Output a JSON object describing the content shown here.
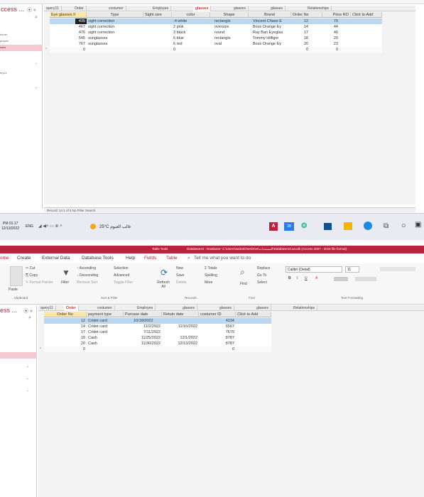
{
  "top": {
    "nav_title": "ccess ...",
    "tabs": [
      "query11",
      "Order",
      "costumer",
      "Employee",
      "glasses",
      "glasses",
      "glasses",
      "Relationships"
    ],
    "active_tab_index": 4,
    "columns": [
      "Eye glasses II",
      "Type",
      "Sight size",
      "color",
      "Shape",
      "Brand",
      "Order No",
      "Price RO",
      "Click to Add"
    ],
    "rows": [
      [
        "435",
        "sight correction",
        "",
        "-4 white",
        "rectangle",
        "Vincent Chase E",
        "12",
        "70"
      ],
      [
        "467",
        "sight correction",
        "",
        "2 pink",
        "oversize",
        "Boss Orange Ey",
        "14",
        "44"
      ],
      [
        "476",
        "sight correction",
        "",
        "3 black",
        "round",
        "Ray Ban Eyeglas",
        "17",
        "40"
      ],
      [
        "545",
        "sunglasses",
        "",
        "6 blue",
        "rectangle",
        "Tommy Hilfiger",
        "18",
        "20"
      ],
      [
        "767",
        "sunglasses",
        "",
        "6 red",
        "oval",
        "Boss Orange Ey",
        "20",
        "23"
      ],
      [
        "0",
        "",
        "",
        "0",
        "",
        "",
        "0",
        "0"
      ]
    ],
    "nav_items": [
      "tumer",
      "ployee",
      "sses",
      "ery11"
    ],
    "record_nav": "Record: 14  1 of 5   No Filter  Search"
  },
  "taskbar": {
    "time": "PM 01:17",
    "date": "12/13/2022",
    "lang": "ENG",
    "weather": "25°C غالب الغيوم",
    "notif": "28"
  },
  "bottom": {
    "nav_title": "ess ...",
    "title_left": "Table Tools",
    "title": "Database10 : Database- C:\\Users\\sa3ra\\OneDrive\\المستندات\\Database10.accdb (Access 2007 - 2016 file format) -",
    "menu": [
      "ome",
      "Create",
      "External Data",
      "Database Tools",
      "Help",
      "Fields",
      "Table",
      "Tell me what you want to do"
    ],
    "ribbon": {
      "cut": "Cut",
      "copy": "Copy",
      "format_painter": "Format Painter",
      "paste": "Paste",
      "filter": "Filter",
      "ascending": "Ascending",
      "descending": "Descending",
      "remove_sort": "Remove Sort",
      "selection": "Selection",
      "advanced": "Advanced",
      "toggle_filter": "Toggle Filter",
      "refresh": "Refresh All",
      "new": "New",
      "save": "Save",
      "delete": "Delete",
      "totals": "Totals",
      "spelling": "Spelling",
      "more": "More",
      "find": "Find",
      "replace": "Replace",
      "goto": "Go To",
      "select": "Select",
      "font": "Calibri (Detail)",
      "font_size": "11",
      "groups": [
        "Clipboard",
        "Sort & Filter",
        "Records",
        "Find",
        "Text Formatting"
      ]
    },
    "tabs": [
      "query11",
      "Order",
      "costumer",
      "Employee",
      "glasses",
      "glasses",
      "glasses",
      "Relationships"
    ],
    "active_tab_index": 1,
    "columns": [
      "Order No",
      "payment type",
      "Purcase date",
      "Retutn date",
      "costumer ID",
      "Click to Add"
    ],
    "rows": [
      [
        "12",
        "Cridet card",
        "10/18/2022",
        "",
        "4234"
      ],
      [
        "14",
        "Cridet card",
        "11/2/2022",
        "11/10/2022",
        "6567"
      ],
      [
        "17",
        "Cridet card",
        "7/11/2022",
        "",
        "7679"
      ],
      [
        "18",
        "Cash",
        "11/25/2022",
        "12/1/2022",
        "8787"
      ],
      [
        "20",
        "Cash",
        "11/30/2022",
        "12/13/2022",
        "8787"
      ],
      [
        "0",
        "",
        "",
        "",
        "0"
      ]
    ]
  },
  "colors": {
    "access_red": "#b8233e",
    "selected_row": "#bcd8f0",
    "nav_selected": "#f4c9d2"
  }
}
